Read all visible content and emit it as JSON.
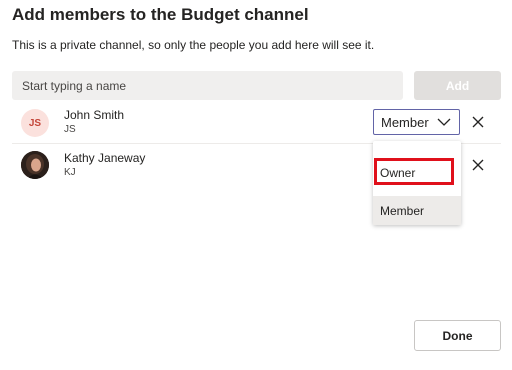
{
  "dialog": {
    "title": "Add members to the Budget channel",
    "subtitle": "This is a private channel, so only the people you add here will see it."
  },
  "search": {
    "placeholder": "Start typing a name",
    "value": ""
  },
  "add_button": {
    "label": "Add",
    "enabled": false
  },
  "members": [
    {
      "name": "John Smith",
      "initials": "JS",
      "avatar": "initials",
      "role": "Member"
    },
    {
      "name": "Kathy Janeway",
      "initials": "KJ",
      "avatar": "photo"
    }
  ],
  "role_dropdown": {
    "selected": "Member",
    "options": [
      "Owner",
      "Member"
    ],
    "highlighted_option": "Owner"
  },
  "done_button": {
    "label": "Done"
  },
  "colors": {
    "accent": "#6264a7",
    "highlight_border": "#e0101b",
    "avatar_bg": "#fbe1dd",
    "avatar_text": "#c4463a"
  },
  "icons": [
    "chevron-down-icon",
    "close-icon"
  ]
}
